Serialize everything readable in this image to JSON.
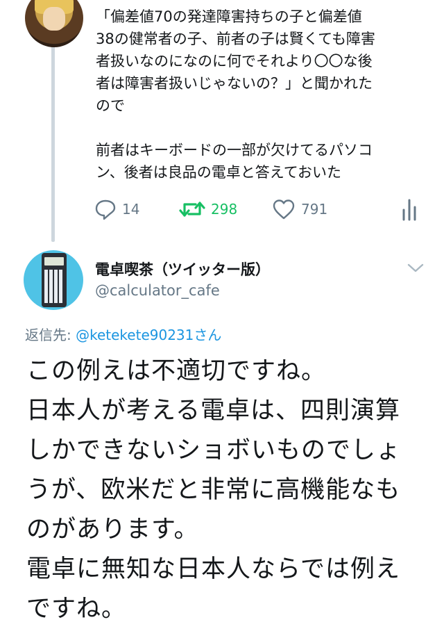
{
  "thread": {
    "prev_tweet": {
      "text": "「偏差値70の発達障害持ちの子と偏差値\n38の健常者の子、前者の子は賢くても障害\n者扱いなのになのに何でそれより〇〇な後\n者は障害者扱いじゃないの？」と聞かれた\nので\n\n前者はキーボードの一部が欠けてるパソコ\nン、後者は良品の電卓と答えておいた",
      "replies": "14",
      "retweets": "298",
      "likes": "791"
    }
  },
  "reply_tweet": {
    "author_name": "電卓喫茶（ツイッター版）",
    "author_handle": "@calculator_cafe",
    "reply_to_label": "返信先: ",
    "reply_to_user": "@ketekete90231",
    "reply_to_suffix": "さん",
    "text": "この例えは不適切ですね。\n日本人が考える電卓は、四則演算\nしかできないショボいものでしょ\nうが、欧米だと非常に高機能なも\nのがあります。\n電卓に無知な日本人ならでは例え\nですね。"
  },
  "colors": {
    "text": "#14171a",
    "secondary": "#657786",
    "retweet": "#17bf63",
    "link": "#1b95e0",
    "thread_line": "#cdd6dd"
  },
  "icons": [
    "reply-icon",
    "retweet-icon",
    "like-icon",
    "analytics-icon",
    "chevron-down-icon"
  ]
}
